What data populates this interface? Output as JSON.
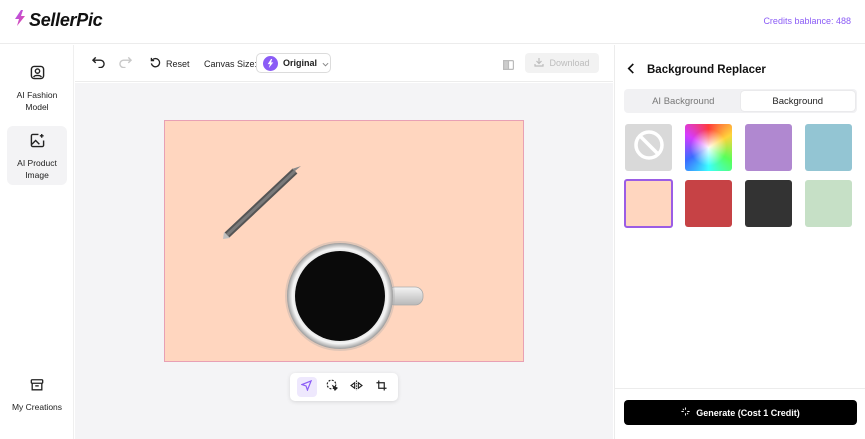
{
  "header": {
    "app_name": "SellerPic",
    "credits_text": "Credits bablance: 488",
    "brand_color": "#8b5cf6"
  },
  "sidebar": {
    "items": [
      {
        "label_line1": "AI Fashion",
        "label_line2": "Model",
        "icon": "person-frame-icon"
      },
      {
        "label_line1": "AI Product",
        "label_line2": "Image",
        "icon": "image-sparkle-icon"
      },
      {
        "label_line1": "My Creations",
        "label_line2": "",
        "icon": "archive-box-icon"
      }
    ]
  },
  "toolbar": {
    "undo": "undo-icon",
    "redo": "redo-icon",
    "reset_label": "Reset",
    "canvas_size_label": "Canvas Size:",
    "canvas_size_value": "Original",
    "download_label": "Download"
  },
  "canvas": {
    "background_color": "#ffd6bf"
  },
  "tools": [
    "pointer-icon",
    "lasso-select-icon",
    "flip-icon",
    "crop-icon"
  ],
  "panel": {
    "title": "Background Replacer",
    "tabs": [
      {
        "label": "AI Background",
        "active": false
      },
      {
        "label": "Background",
        "active": true
      }
    ],
    "swatches": [
      {
        "name": "none",
        "color": "#d9d9d9"
      },
      {
        "name": "rainbow",
        "color": "conic"
      },
      {
        "name": "purple",
        "color": "#b088d0"
      },
      {
        "name": "light-blue",
        "color": "#93c5d3"
      },
      {
        "name": "peach",
        "color": "#ffd6bf",
        "selected": true
      },
      {
        "name": "red",
        "color": "#c64245"
      },
      {
        "name": "dark-gray",
        "color": "#333333"
      },
      {
        "name": "mint",
        "color": "#c6e0c6"
      }
    ],
    "generate_label": "Generate (Cost 1 Credit)"
  }
}
